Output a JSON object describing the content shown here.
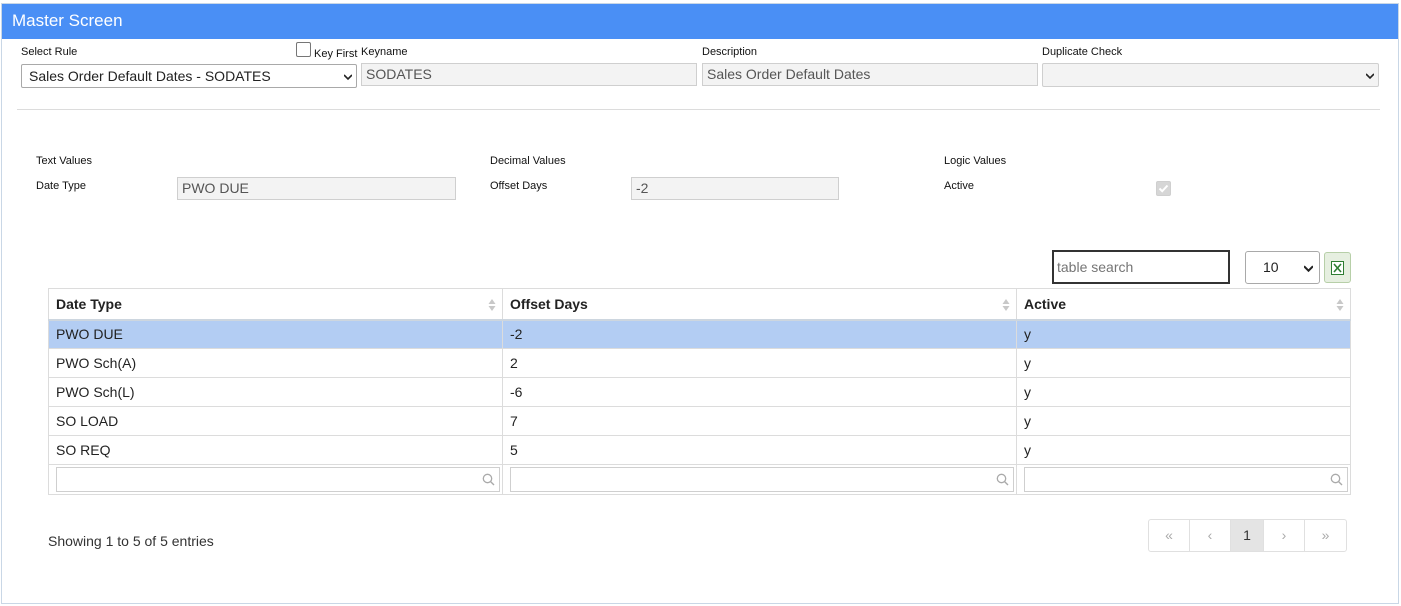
{
  "window": {
    "title": "Master Screen"
  },
  "header": {
    "select_rule_label": "Select Rule",
    "select_rule_value": "Sales Order Default Dates - SODATES",
    "key_first_label": "Key First",
    "keyname_label": "Keyname",
    "keyname_value": "SODATES",
    "description_label": "Description",
    "description_value": "Sales Order Default Dates",
    "duplicate_check_label": "Duplicate Check",
    "duplicate_check_value": ""
  },
  "values": {
    "text_values_label": "Text Values",
    "date_type_label": "Date Type",
    "date_type_value": "PWO DUE",
    "decimal_values_label": "Decimal Values",
    "offset_days_label": "Offset Days",
    "offset_days_value": "-2",
    "logic_values_label": "Logic Values",
    "active_label": "Active",
    "active_checked": true
  },
  "table": {
    "search_placeholder": "table search",
    "page_size": "10",
    "columns": [
      "Date Type",
      "Offset Days",
      "Active"
    ],
    "rows": [
      [
        "PWO DUE",
        "-2",
        "y"
      ],
      [
        "PWO Sch(A)",
        "2",
        "y"
      ],
      [
        "PWO Sch(L)",
        "-6",
        "y"
      ],
      [
        "SO LOAD",
        "7",
        "y"
      ],
      [
        "SO REQ",
        "5",
        "y"
      ]
    ],
    "selected_row": 0,
    "info": "Showing 1 to 5 of 5 entries",
    "pagination": {
      "first": "«",
      "prev": "‹",
      "current": "1",
      "next": "›",
      "last": "»"
    }
  },
  "colors": {
    "titlebar": "#4a8ff5",
    "selected_row": "#b3cdf3"
  }
}
